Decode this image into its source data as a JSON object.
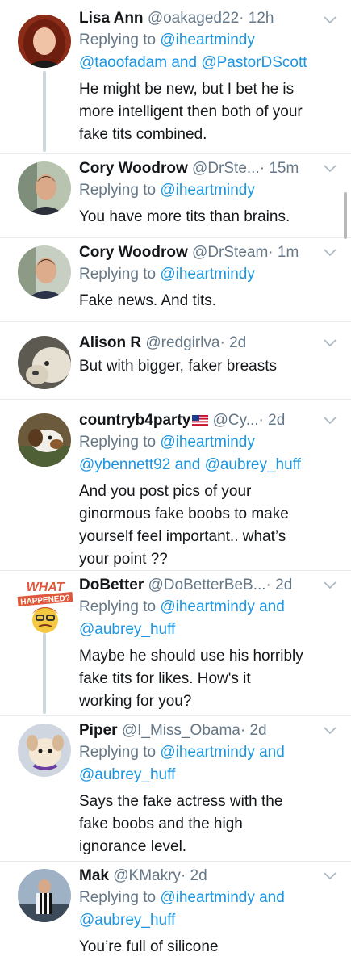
{
  "tweets": [
    {
      "name": "Lisa Ann",
      "handle": "@oakaged22",
      "time": "· 12h",
      "replying_prefix": "Replying to ",
      "replying_line1": "@iheartmindy",
      "replying_line2": "@taoofadam and @PastorDScott",
      "text_lines": [
        "He might be new, but I bet he is",
        "more intelligent then both of your",
        "fake tits combined."
      ]
    },
    {
      "name": "Cory Woodrow",
      "handle": "@DrSte...",
      "time": "· 15m",
      "replying_prefix": "Replying to ",
      "replying_line1": "@iheartmindy",
      "text_lines": [
        "You have more tits than brains."
      ]
    },
    {
      "name": "Cory Woodrow",
      "handle": "@DrSteam",
      "time": "· 1m",
      "replying_prefix": "Replying to ",
      "replying_line1": "@iheartmindy",
      "text_lines": [
        "Fake news. And tits."
      ]
    },
    {
      "name": "Alison R",
      "handle": "@redgirlva",
      "time": "· 2d",
      "text_lines": [
        "But with bigger, faker breasts"
      ]
    },
    {
      "name": "countryb4party",
      "handle": "@Cy...",
      "time": "· 2d",
      "replying_prefix": "Replying to ",
      "replying_line1": "@iheartmindy",
      "replying_line2": "@ybennett92 and @aubrey_huff",
      "text_lines": [
        "And you post pics of your",
        "ginormous fake boobs to make",
        "yourself feel important.. what’s",
        "your point ??"
      ]
    },
    {
      "name": "DoBetter",
      "handle": "@DoBetterBeB...",
      "time": "· 2d",
      "replying_prefix": "Replying to ",
      "replying_line1": "@iheartmindy and",
      "replying_line2": "@aubrey_huff",
      "text_lines": [
        "Maybe he should use his horribly",
        "fake tits for likes. How's it",
        "working for you?"
      ],
      "avatar_text_top": "WHAT",
      "avatar_text_bottom": "HAPPENED?"
    },
    {
      "name": "Piper",
      "handle": "@I_Miss_Obama",
      "time": "· 2d",
      "replying_prefix": "Replying to ",
      "replying_line1": "@iheartmindy and",
      "replying_line2": "@aubrey_huff",
      "text_lines": [
        "Says the fake actress with the",
        "fake boobs and the high",
        "ignorance level."
      ]
    },
    {
      "name": "Mak",
      "handle": "@KMakry",
      "time": "· 2d",
      "replying_prefix": "Replying to ",
      "replying_line1": "@iheartmindy and",
      "replying_line2": "@aubrey_huff",
      "text_lines": [
        "You’re full of silicone"
      ]
    }
  ],
  "icons": {
    "chevron": "chevron-down-icon",
    "flag": "us-flag-emoji"
  },
  "colors": {
    "link": "#1b95e0",
    "secondary": "#657786",
    "primary": "#14171a",
    "thread": "#ccd6dd"
  }
}
